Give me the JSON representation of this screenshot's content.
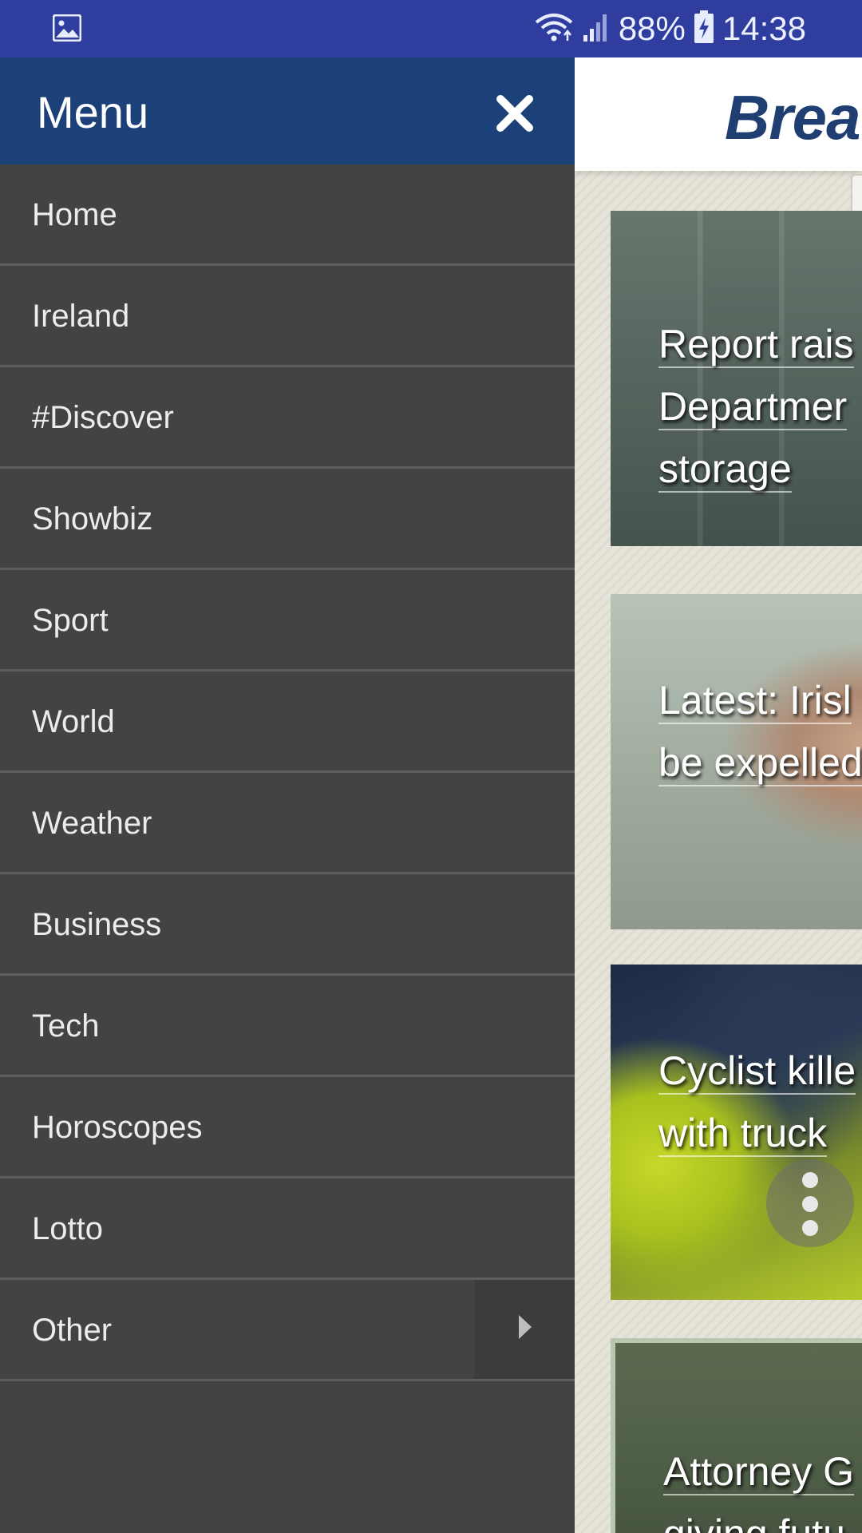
{
  "status_bar": {
    "battery": "88%",
    "time": "14:38",
    "icons": [
      "gallery-icon",
      "wifi-icon",
      "signal-icon",
      "battery-charging-icon"
    ]
  },
  "background_page": {
    "logo_text": "Brea",
    "articles": [
      {
        "headline": "Report rais\nDepartmer\nstorage"
      },
      {
        "headline": "Latest: Irisl\nbe expelled"
      },
      {
        "headline": "Cyclist kille\nwith truck"
      },
      {
        "headline": "Attorney G\ngiving futu"
      }
    ]
  },
  "drawer": {
    "title": "Menu",
    "close_icon": "close-icon",
    "items": [
      {
        "label": "Home"
      },
      {
        "label": "Ireland"
      },
      {
        "label": "#Discover"
      },
      {
        "label": "Showbiz"
      },
      {
        "label": "Sport"
      },
      {
        "label": "World"
      },
      {
        "label": "Weather"
      },
      {
        "label": "Business"
      },
      {
        "label": "Tech"
      },
      {
        "label": "Horoscopes"
      },
      {
        "label": "Lotto"
      },
      {
        "label": "Other"
      }
    ],
    "expand_icon": "chevron-right-icon"
  },
  "colors": {
    "status_bar": "#2f3d9f",
    "drawer_header": "#1c4179",
    "drawer_bg": "#434343",
    "divider": "#5e5e5e"
  }
}
